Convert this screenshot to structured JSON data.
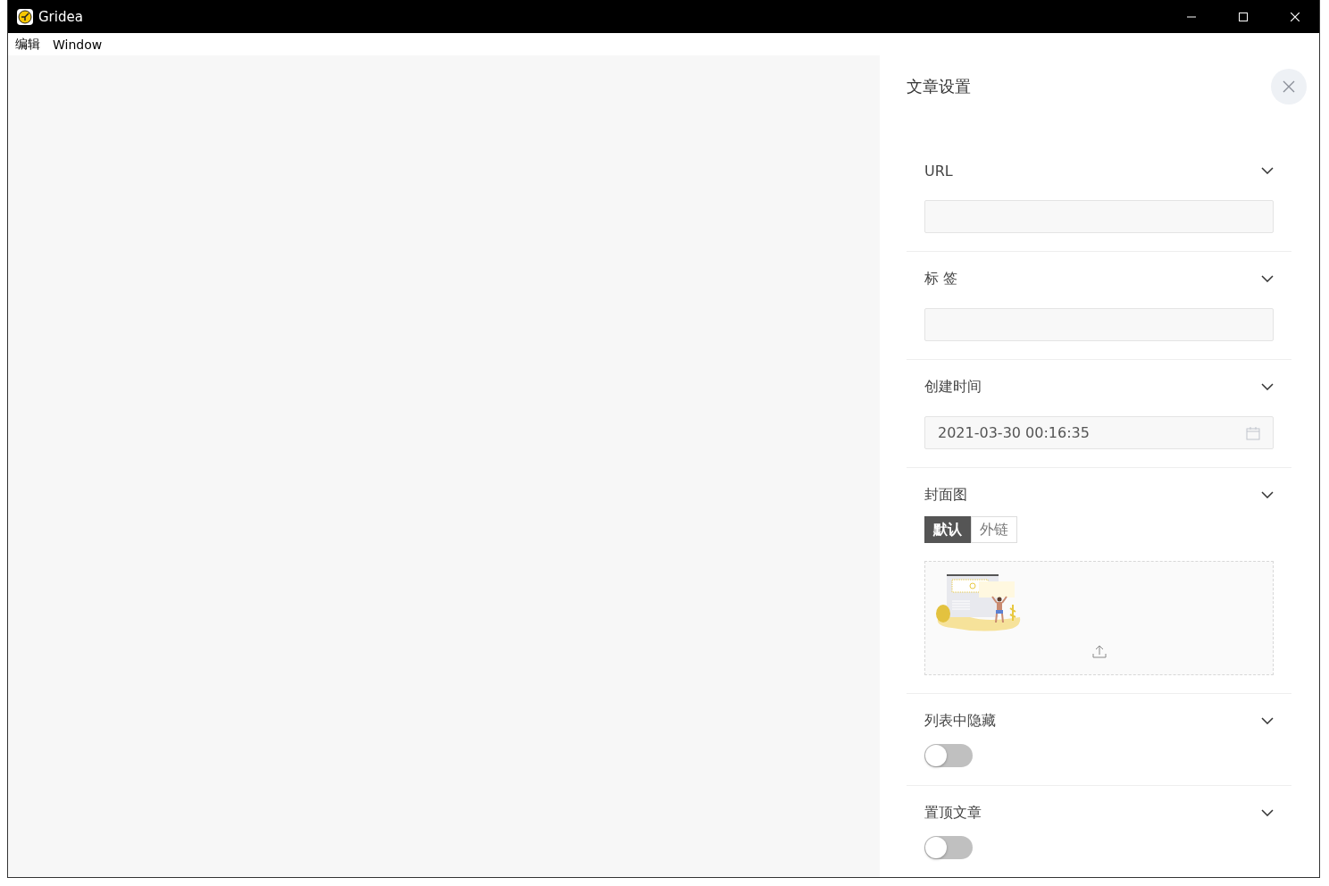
{
  "window": {
    "title": "Gridea"
  },
  "menu": [
    "编辑",
    "Window"
  ],
  "panel": {
    "title": "文章设置",
    "sections": [
      {
        "kind": "text",
        "label": "URL"
      },
      {
        "kind": "text",
        "label": "标 签"
      },
      {
        "kind": "date",
        "label": "创建时间",
        "value": "2021-03-30 00:16:35"
      },
      {
        "kind": "cover",
        "label": "封面图",
        "tabs": [
          {
            "label": "默认",
            "selected": true
          },
          {
            "label": "外链",
            "selected": false
          }
        ]
      },
      {
        "kind": "switch",
        "label": "列表中隐藏",
        "on": false
      },
      {
        "kind": "switch",
        "label": "置顶文章",
        "on": false
      }
    ]
  }
}
